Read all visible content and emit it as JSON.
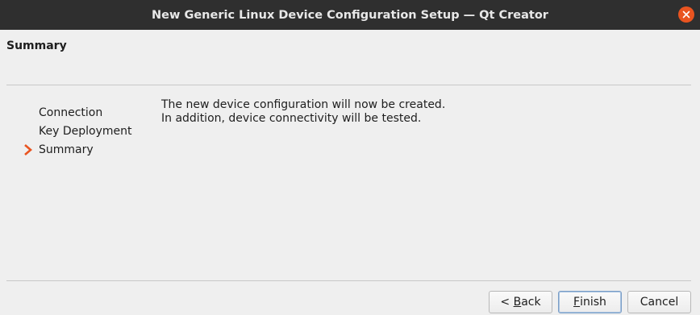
{
  "window": {
    "title": "New Generic Linux Device Configuration Setup — Qt Creator"
  },
  "page": {
    "header": "Summary"
  },
  "steps": [
    {
      "label": "Connection",
      "current": false
    },
    {
      "label": "Key Deployment",
      "current": false
    },
    {
      "label": "Summary",
      "current": true
    }
  ],
  "content": {
    "line1": "The new device configuration will now be created.",
    "line2": "In addition, device connectivity will be tested."
  },
  "buttons": {
    "back_prefix": "< ",
    "back_mnemonic": "B",
    "back_rest": "ack",
    "finish_mnemonic": "F",
    "finish_rest": "inish",
    "cancel": "Cancel"
  },
  "colors": {
    "titlebar": "#2f2f2f",
    "close": "#e95420",
    "current_step_arrow": "#e95420"
  },
  "icons": {
    "close": "close-icon",
    "current_step": "chevron-right-icon"
  }
}
